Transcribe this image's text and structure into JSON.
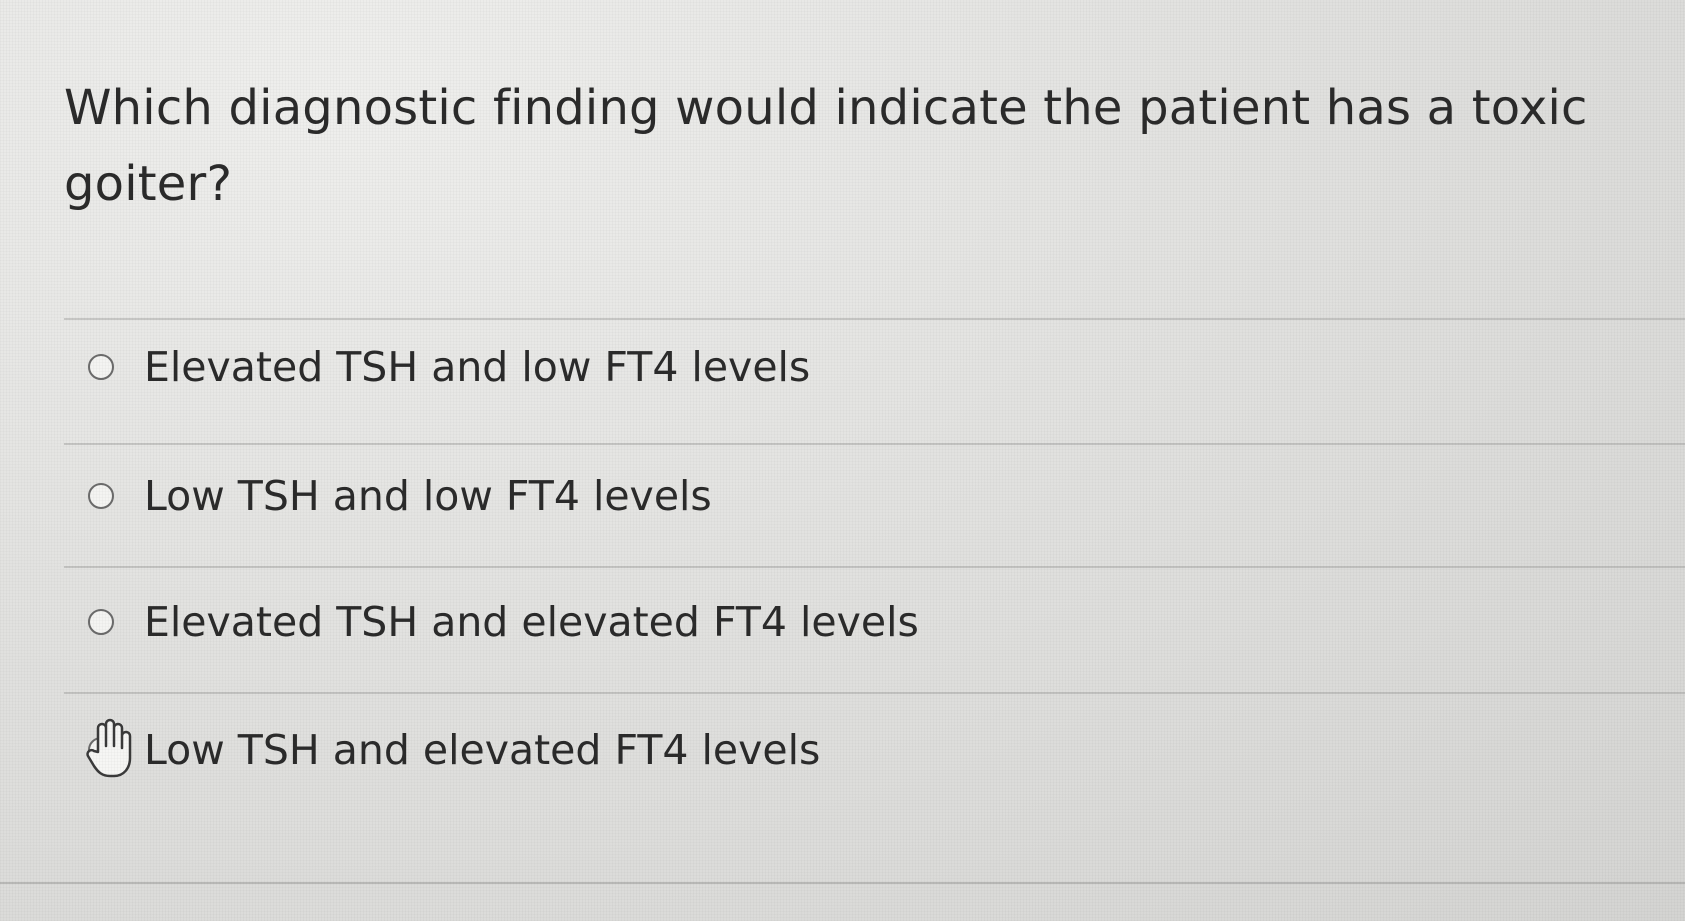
{
  "question": {
    "text": "Which diagnostic finding would indicate the patient has a toxic goiter?"
  },
  "options": [
    {
      "label": "Elevated TSH and low FT4 levels"
    },
    {
      "label": "Low TSH and low FT4 levels"
    },
    {
      "label": "Elevated TSH and elevated FT4 levels"
    },
    {
      "label": "Low TSH and elevated FT4 levels"
    }
  ],
  "cursor": {
    "icon": "hand-pointer-icon"
  }
}
